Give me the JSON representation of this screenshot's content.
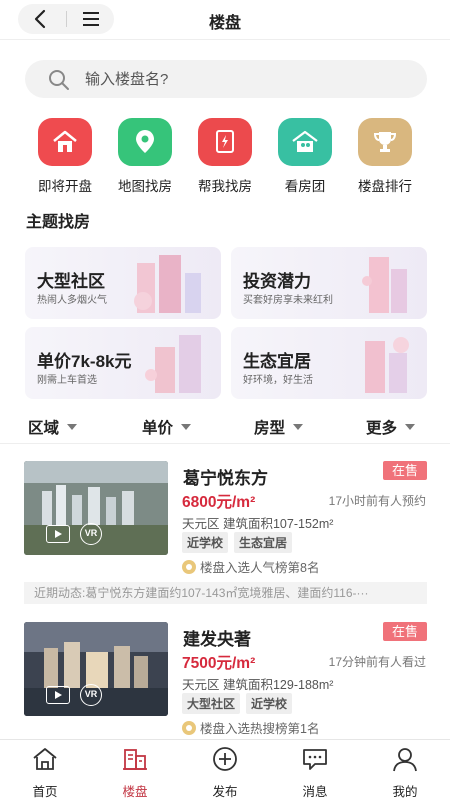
{
  "header": {
    "title": "楼盘"
  },
  "search": {
    "placeholder": "输入楼盘名?"
  },
  "quick_actions": [
    {
      "label": "即将开盘",
      "icon": "home-icon",
      "color": "#ef4b4f"
    },
    {
      "label": "地图找房",
      "icon": "map-pin-icon",
      "color": "#36c47a"
    },
    {
      "label": "帮我找房",
      "icon": "flash-document-icon",
      "color": "#ec4a4d"
    },
    {
      "label": "看房团",
      "icon": "house-people-icon",
      "color": "#38c0a2"
    },
    {
      "label": "楼盘排行",
      "icon": "trophy-icon",
      "color": "#d9b77f"
    }
  ],
  "theme_section": {
    "title": "主题找房",
    "cards": [
      {
        "title": "大型社区",
        "subtitle": "热闹人多烟火气"
      },
      {
        "title": "投资潜力",
        "subtitle": "买套好房享未来红利"
      },
      {
        "title": "单价7k-8k元",
        "subtitle": "刚需上车首选"
      },
      {
        "title": "生态宜居",
        "subtitle": "好环境，好生活"
      }
    ]
  },
  "filters": [
    "区域",
    "单价",
    "房型",
    "更多"
  ],
  "listings": [
    {
      "name": "葛宁悦东方",
      "status": "在售",
      "price": "6800元/m²",
      "activity": "17小时前有人预约",
      "area": "天元区  建筑面积107-152m²",
      "tags": [
        "近学校",
        "生态宜居"
      ],
      "rank": "楼盘入选人气榜第8名",
      "news": "近期动态:葛宁悦东方建面约107-143㎡宽境雅居、建面约116-···"
    },
    {
      "name": "建发央著",
      "status": "在售",
      "price": "7500元/m²",
      "activity": "17分钟前有人看过",
      "area": "天元区  建筑面积129-188m²",
      "tags": [
        "大型社区",
        "近学校"
      ],
      "rank": "楼盘入选热搜榜第1名"
    }
  ],
  "bottom_nav": [
    {
      "label": "首页",
      "icon": "home-outline-icon",
      "active": false
    },
    {
      "label": "楼盘",
      "icon": "buildings-icon",
      "active": true
    },
    {
      "label": "发布",
      "icon": "plus-circle-icon",
      "active": false
    },
    {
      "label": "消息",
      "icon": "chat-bubble-icon",
      "active": false
    },
    {
      "label": "我的",
      "icon": "user-icon",
      "active": false
    }
  ],
  "colors": {
    "accent": "#c23643",
    "price": "#d62a3d",
    "status": "#f0727a"
  }
}
